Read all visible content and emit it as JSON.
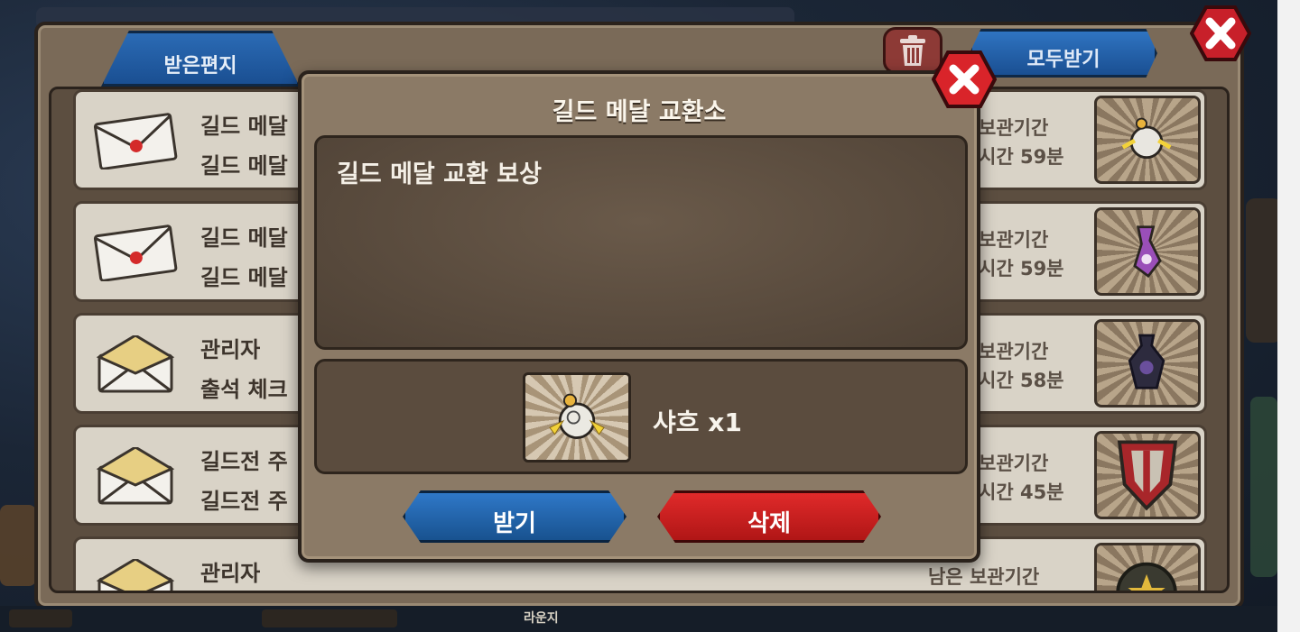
{
  "mailbox": {
    "tab_received": "받은편지",
    "take_all": "모두받기",
    "colors": {
      "tab_blue": "#1a4f92",
      "close_red": "#d9242a",
      "panel": "#7a6a58"
    },
    "rows": [
      {
        "line1": "길드 메달",
        "line2": "길드 메달",
        "right1": "보관기간",
        "right2": "시간 59분",
        "icon": "sealed-envelope-icon",
        "thumb": "orb-item-icon"
      },
      {
        "line1": "길드 메달",
        "line2": "길드 메달",
        "right1": "보관기간",
        "right2": "시간 59분",
        "icon": "sealed-envelope-icon",
        "thumb": "potion-item-icon"
      },
      {
        "line1": "관리자",
        "line2": "출석 체크",
        "right1": "보관기간",
        "right2": "시간 58분",
        "icon": "open-envelope-icon",
        "thumb": "vase-item-icon"
      },
      {
        "line1": "길드전 주",
        "line2": "길드전 주",
        "right1": "보관기간",
        "right2": "시간 45분",
        "icon": "open-envelope-icon",
        "thumb": "emblem-item-icon"
      },
      {
        "line1": "관리자",
        "line2": "",
        "right1": "남은 보관기간",
        "right2": "",
        "icon": "open-envelope-icon",
        "thumb": "badge-item-icon"
      }
    ]
  },
  "modal": {
    "title": "길드 메달 교환소",
    "message": "길드 메달 교환 보상",
    "reward_label": "샤흐 x1",
    "receive_button": "받기",
    "delete_button": "삭제",
    "colors": {
      "receive": "#1a5aa0",
      "delete": "#c81c1c"
    }
  },
  "bottom_bar": {
    "label": "라운지"
  }
}
